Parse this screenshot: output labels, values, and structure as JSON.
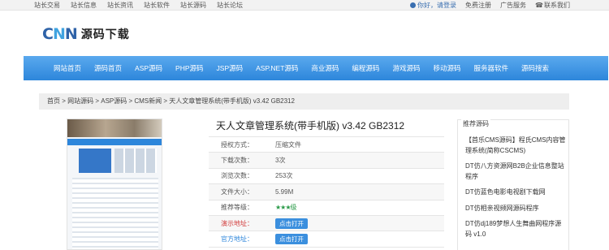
{
  "topbar": {
    "links": [
      "站长交易",
      "站长信息",
      "站长资讯",
      "站长软件",
      "站长源码",
      "站长论坛"
    ],
    "user": "你好，请登录",
    "register": "免费注册",
    "ads": "广告服务",
    "contact": "联系我们"
  },
  "logo": {
    "mark_left": "C",
    "mark_mid": "N",
    "mark_right": "N",
    "text": "源码下载"
  },
  "nav": {
    "items": [
      "网站首页",
      "源码首页",
      "ASP源码",
      "PHP源码",
      "JSP源码",
      "ASP.NET源码",
      "商业源码",
      "编程源码",
      "游戏源码",
      "移动源码",
      "服务器软件",
      "源码搜索"
    ]
  },
  "breadcrumb": "首页 > 网站源码 > ASP源码 > CMS新闻 > 天人文章管理系统(带手机版) v3.42 GB2312",
  "title": "天人文章管理系统(带手机版) v3.42 GB2312",
  "info": {
    "rows": [
      {
        "label": "授权方式：",
        "value": "压缩文件"
      },
      {
        "label": "下载次数：",
        "value": "3次"
      },
      {
        "label": "浏览次数：",
        "value": "253次"
      },
      {
        "label": "文件大小：",
        "value": "5.99M"
      },
      {
        "label": "推荐等级：",
        "value": "★★★级"
      },
      {
        "label": "演示地址：",
        "button": "点击打开"
      },
      {
        "label": "官方地址：",
        "button": "点击打开"
      }
    ]
  },
  "recommended": {
    "title": "推荐源码",
    "items": [
      "【首乐CMS源码】程氏CMS内容管理系统(简称CSCMS)",
      "DT仿八方资源网B2B企业信息整站程序",
      "DT仿蓝色电影电视剧下载网",
      "DT仿相亲视频网源码程序",
      "DT仿dj189梦想人生舞曲网程序源码 v1.0"
    ]
  },
  "colors": {
    "nav_top": "#5aa9ee",
    "nav_bottom": "#2d86db",
    "logo_blue": "#2f63a8",
    "button_blue": "#3b8fde",
    "demo_label_red": "#d23b3b",
    "star_green": "#2c9b4a"
  }
}
